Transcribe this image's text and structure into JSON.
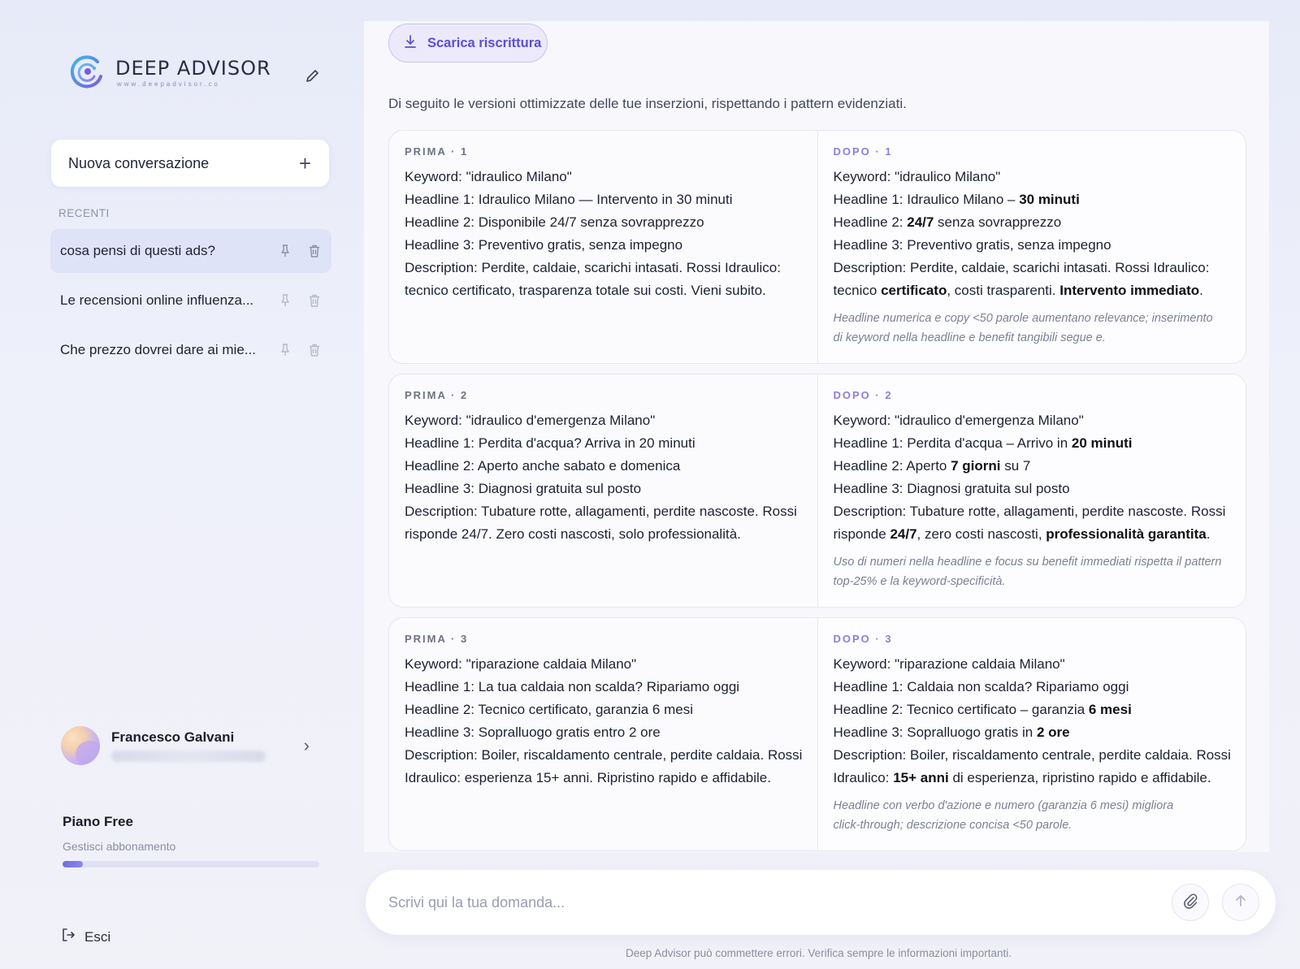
{
  "brand": {
    "title": "DEEP ADVISOR",
    "subtitle": "www.deepadvisor.co"
  },
  "sidebar": {
    "new_conversation_label": "Nuova conversazione",
    "recent_label": "RECENTI",
    "conversations": [
      {
        "title": "cosa pensi di questi ads?"
      },
      {
        "title": "Le recensioni online influenza..."
      },
      {
        "title": "Che prezzo dovrei dare ai mie..."
      }
    ],
    "user": {
      "name": "Francesco Galvani"
    },
    "plan": {
      "name": "Piano Free",
      "manage_label": "Gestisci abbonamento",
      "usage_fraction": 0.08
    },
    "logout_label": "Esci"
  },
  "main": {
    "download_label": "Scarica riscrittura",
    "intro": "Di seguito le versioni ottimizzate delle tue inserzioni, rispettando i pattern evidenziati.",
    "cards": [
      {
        "before_head": "PRIMA · 1",
        "after_head": "DOPO · 1",
        "before": [
          "Keyword: \"idraulico Milano\"",
          "Headline 1: Idraulico Milano — Intervento in 30 minuti",
          "Headline 2: Disponibile 24/7 senza sovrapprezzo",
          "Headline 3: Preventivo gratis, senza impegno",
          "Description: Perdite, caldaie, scarichi intasati. Rossi Idraulico:",
          "tecnico certificato, trasparenza totale sui costi. Vieni subito."
        ],
        "after": [
          [
            {
              "t": "Keyword: \"idraulico Milano\""
            }
          ],
          [
            {
              "t": "Headline 1: Idraulico Milano – "
            },
            {
              "t": "30 minuti",
              "b": true
            }
          ],
          [
            {
              "t": "Headline 2: "
            },
            {
              "t": "24/7",
              "b": true
            },
            {
              "t": " senza sovrapprezzo"
            }
          ],
          [
            {
              "t": "Headline 3: Preventivo gratis, senza impegno"
            }
          ],
          [
            {
              "t": "Description: Perdite, caldaie, scarichi intasati. Rossi Idraulico:"
            }
          ],
          [
            {
              "t": "tecnico "
            },
            {
              "t": "certificato",
              "b": true
            },
            {
              "t": ", costi trasparenti. "
            },
            {
              "t": "Intervento immediato",
              "b": true
            },
            {
              "t": "."
            }
          ]
        ],
        "note": [
          "Headline numerica e copy <50 parole aumentano relevance; inserimento",
          "di keyword nella headline e benefit tangibili segue e."
        ]
      },
      {
        "before_head": "PRIMA · 2",
        "after_head": "DOPO · 2",
        "before": [
          "Keyword: \"idraulico d'emergenza Milano\"",
          "Headline 1: Perdita d'acqua? Arriva in 20 minuti",
          "Headline 2: Aperto anche sabato e domenica",
          "Headline 3: Diagnosi gratuita sul posto",
          "Description: Tubature rotte, allagamenti, perdite nascoste. Rossi",
          "risponde 24/7. Zero costi nascosti, solo professionalità."
        ],
        "after": [
          [
            {
              "t": "Keyword: \"idraulico d'emergenza Milano\""
            }
          ],
          [
            {
              "t": "Headline 1: Perdita d'acqua – Arrivo in "
            },
            {
              "t": "20 minuti",
              "b": true
            }
          ],
          [
            {
              "t": "Headline 2: Aperto "
            },
            {
              "t": "7 giorni",
              "b": true
            },
            {
              "t": " su 7"
            }
          ],
          [
            {
              "t": "Headline 3: Diagnosi gratuita sul posto"
            }
          ],
          [
            {
              "t": "Description: Tubature rotte, allagamenti, perdite nascoste. Rossi"
            }
          ],
          [
            {
              "t": "risponde "
            },
            {
              "t": "24/7",
              "b": true
            },
            {
              "t": ", zero costi nascosti, "
            },
            {
              "t": "professionalità garantita",
              "b": true
            },
            {
              "t": "."
            }
          ]
        ],
        "note": [
          "Uso di numeri nella headline e focus su benefit immediati rispetta il pattern",
          "top-25% e la keyword-specificità."
        ]
      },
      {
        "before_head": "PRIMA · 3",
        "after_head": "DOPO · 3",
        "before": [
          "Keyword: \"riparazione caldaia Milano\"",
          "Headline 1: La tua caldaia non scalda? Ripariamo oggi",
          "Headline 2: Tecnico certificato, garanzia 6 mesi",
          "Headline 3: Sopralluogo gratis entro 2 ore",
          "Description: Boiler, riscaldamento centrale, perdite caldaia. Rossi",
          "Idraulico: esperienza 15+ anni. Ripristino rapido e affidabile."
        ],
        "after": [
          [
            {
              "t": "Keyword: \"riparazione caldaia Milano\""
            }
          ],
          [
            {
              "t": "Headline 1: Caldaia non scalda? Ripariamo oggi"
            }
          ],
          [
            {
              "t": "Headline 2: Tecnico certificato – garanzia "
            },
            {
              "t": "6 mesi",
              "b": true
            }
          ],
          [
            {
              "t": "Headline 3: Sopralluogo gratis in "
            },
            {
              "t": "2 ore",
              "b": true
            }
          ],
          [
            {
              "t": "Description: Boiler, riscaldamento centrale, perdite caldaia. Rossi"
            }
          ],
          [
            {
              "t": "Idraulico: "
            },
            {
              "t": "15+ anni",
              "b": true
            },
            {
              "t": " di esperienza, ripristino rapido e affidabile."
            }
          ]
        ],
        "note": [
          "Headline con verbo d'azione e numero (garanzia 6 mesi) migliora",
          "click-through; descrizione concisa <50 parole."
        ]
      }
    ]
  },
  "composer": {
    "placeholder": "Scrivi qui la tua domanda..."
  },
  "disclaimer": "Deep Advisor può commettere errori. Verifica sempre le informazioni importanti.",
  "colors": {
    "accent": "#5b4fd0",
    "active_conversation": "#dfe3f8"
  },
  "icons": [
    "logo-mark-icon",
    "edit-icon",
    "plus-icon",
    "pin-icon",
    "trash-icon",
    "chevron-right-icon",
    "logout-icon",
    "download-icon",
    "paperclip-icon",
    "arrow-up-icon"
  ]
}
